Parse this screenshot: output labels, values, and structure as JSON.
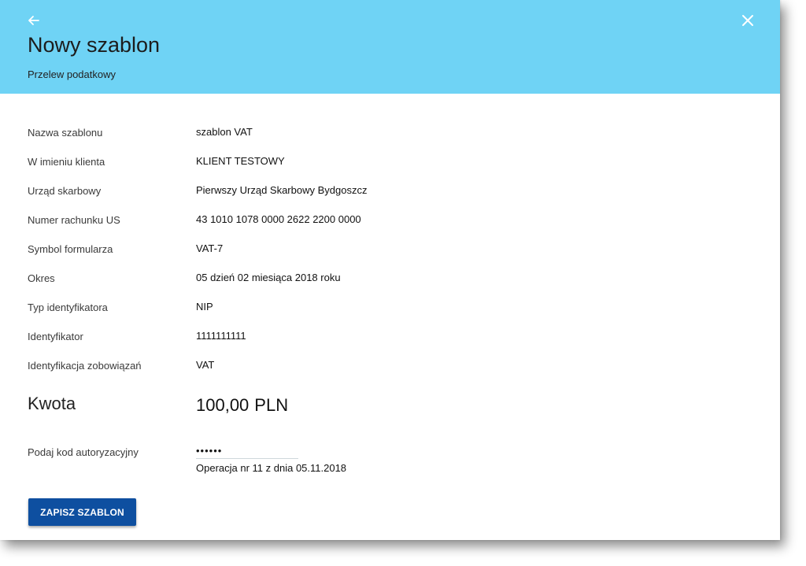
{
  "header": {
    "title": "Nowy szablon",
    "subtitle": "Przelew podatkowy",
    "color": "#6fd3f5"
  },
  "icons": {
    "back": "arrow-left-icon",
    "close": "close-icon"
  },
  "details": [
    {
      "label": "Nazwa szablonu",
      "value": "szablon VAT"
    },
    {
      "label": "W imieniu klienta",
      "value": "KLIENT TESTOWY"
    },
    {
      "label": "Urząd skarbowy",
      "value": "Pierwszy Urząd Skarbowy Bydgoszcz"
    },
    {
      "label": "Numer rachunku US",
      "value": "43 1010 1078 0000 2622 2200 0000"
    },
    {
      "label": "Symbol formularza",
      "value": "VAT-7"
    },
    {
      "label": "Okres",
      "value": "05 dzień 02 miesiąca 2018 roku"
    },
    {
      "label": "Typ identyfikatora",
      "value": "NIP"
    },
    {
      "label": "Identyfikator",
      "value": "1111111111"
    },
    {
      "label": "Identyfikacja zobowiązań",
      "value": "VAT"
    }
  ],
  "amount": {
    "label": "Kwota",
    "value": "100,00",
    "currency": "PLN"
  },
  "auth": {
    "label": "Podaj kod autoryzacyjny",
    "value": "••••••",
    "operation": "Operacja nr 11 z dnia 05.11.2018"
  },
  "actions": {
    "save_label": "ZAPISZ SZABLON",
    "save_color": "#0e4fa0"
  }
}
